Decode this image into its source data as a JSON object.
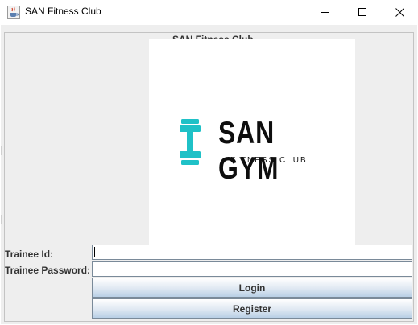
{
  "window": {
    "title": "SAN Fitness Club",
    "icon": "java-cup-icon"
  },
  "panel": {
    "group_title": "SAN Fitness Club"
  },
  "logo": {
    "main_text": "SAN GYM",
    "sub_text": "FITNESS CLUB",
    "icon": "dumbbell-icon",
    "accent_color": "#1fc1c7"
  },
  "form": {
    "trainee_id_label": "Trainee Id:",
    "trainee_id_value": "",
    "trainee_password_label": "Trainee Password:",
    "trainee_password_value": "",
    "login_label": "Login",
    "register_label": "Register"
  }
}
